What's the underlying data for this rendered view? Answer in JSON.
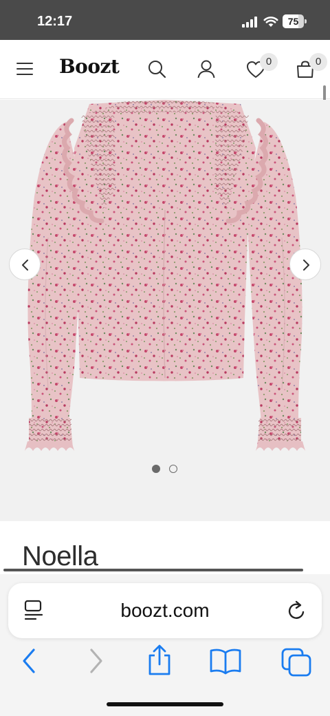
{
  "status_bar": {
    "time": "12:17",
    "battery_percent": "75",
    "battery_level": 0.75,
    "icons": [
      "signal-icon",
      "wifi-icon",
      "battery-icon"
    ]
  },
  "header": {
    "logo": "Boozt",
    "wishlist_count": "0",
    "cart_count": "0",
    "icons": [
      "menu-icon",
      "search-icon",
      "account-icon",
      "heart-icon",
      "bag-icon"
    ]
  },
  "gallery": {
    "slide_count": 2,
    "active_slide": 1,
    "icons": [
      "chevron-left-icon",
      "chevron-right-icon"
    ]
  },
  "product": {
    "title": "Noella"
  },
  "browser": {
    "url": "boozt.com",
    "toolbar_icons": [
      "back-icon",
      "forward-icon",
      "share-icon",
      "bookmarks-icon",
      "tabs-icon"
    ],
    "url_icons": [
      "reader-icon",
      "reload-icon"
    ]
  },
  "colors": {
    "status_bar_bg": "#4a4a4a",
    "gallery_bg": "#f1f1f1",
    "garment_pink": "#e8c3c6",
    "safari_blue": "#1a7cf0"
  }
}
